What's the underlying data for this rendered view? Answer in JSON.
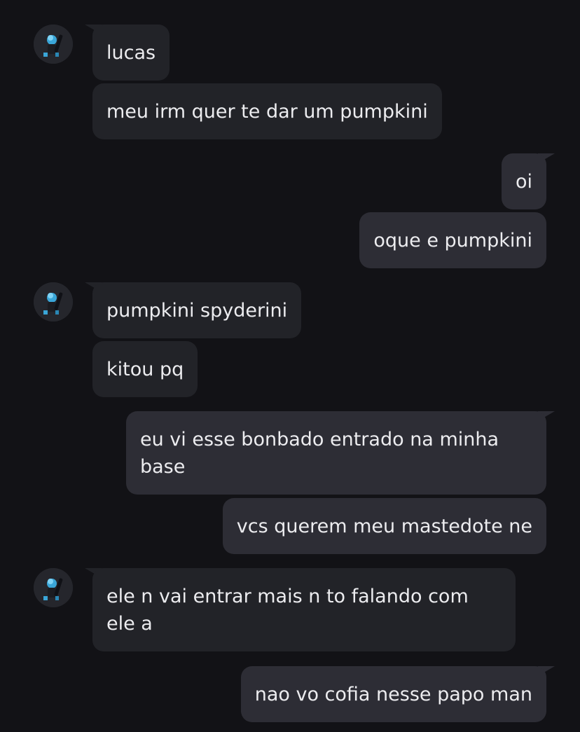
{
  "contact": {
    "avatar_icon": "user-avatar-icon"
  },
  "colors": {
    "background": "#121216",
    "incoming_bubble": "#222328",
    "outgoing_bubble": "#2d2d35",
    "text": "#ececef"
  },
  "messages": [
    {
      "sender": "them",
      "text": "lucas"
    },
    {
      "sender": "them",
      "text": "meu irm quer te dar um pumpkini"
    },
    {
      "sender": "me",
      "text": "oi"
    },
    {
      "sender": "me",
      "text": "oque e pumpkini"
    },
    {
      "sender": "them",
      "text": "pumpkini spyderini"
    },
    {
      "sender": "them",
      "text": "kitou pq"
    },
    {
      "sender": "me",
      "text": "eu vi esse bonbado entrado na minha base"
    },
    {
      "sender": "me",
      "text": "vcs querem meu mastedote ne"
    },
    {
      "sender": "them",
      "text": "ele n vai entrar mais n to falando com ele a"
    },
    {
      "sender": "me",
      "text": "nao vo cofia nesse papo man"
    }
  ]
}
